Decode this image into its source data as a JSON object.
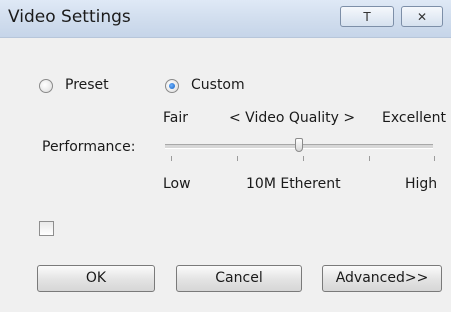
{
  "window": {
    "title": "Video Settings",
    "pin_button_label": "T",
    "close_button_label": "✕"
  },
  "mode": {
    "options": [
      {
        "label": "Preset",
        "checked": false
      },
      {
        "label": "Custom",
        "checked": true
      }
    ]
  },
  "performance": {
    "label": "Performance:",
    "top_left_label": "Fair",
    "top_center_label": "< Video Quality >",
    "top_right_label": "Excellent",
    "bottom_left_label": "Low",
    "bottom_center_label": "10M Etherent",
    "bottom_right_label": "High",
    "slider_fraction": 0.5
  },
  "checkbox": {
    "checked": false
  },
  "buttons": {
    "ok": "OK",
    "cancel": "Cancel",
    "advanced": "Advanced>>"
  }
}
